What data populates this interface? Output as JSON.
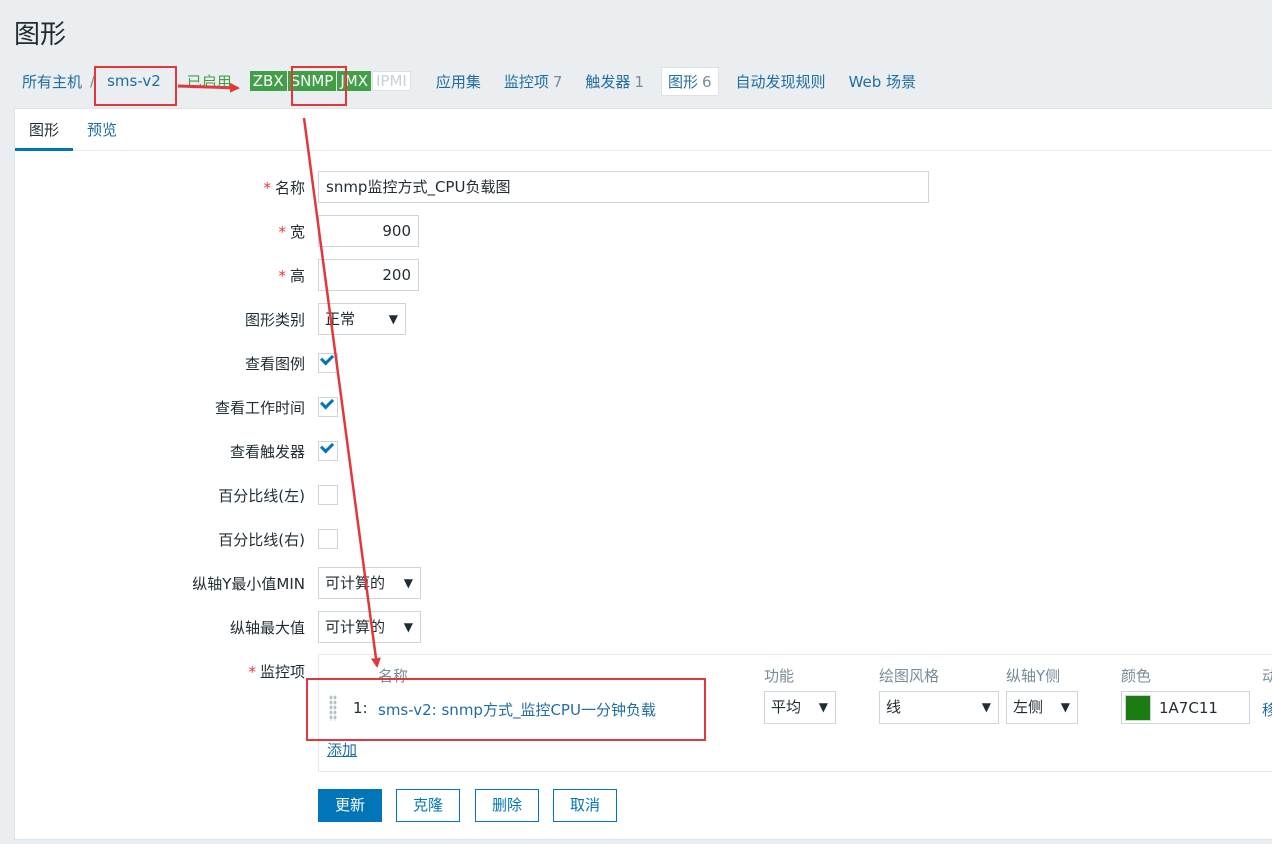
{
  "page": {
    "title": "图形"
  },
  "host_nav": {
    "all_hosts": "所有主机",
    "separator": "/",
    "host": "sms-v2",
    "status": "已启用",
    "availability": [
      {
        "label": "ZBX",
        "state": "on"
      },
      {
        "label": "SNMP",
        "state": "on"
      },
      {
        "label": "JMX",
        "state": "on"
      },
      {
        "label": "IPMI",
        "state": "off"
      }
    ],
    "items": [
      {
        "label": "应用集",
        "count": ""
      },
      {
        "label": "监控项",
        "count": "7"
      },
      {
        "label": "触发器",
        "count": "1"
      },
      {
        "label": "图形",
        "count": "6",
        "active": true
      },
      {
        "label": "自动发现规则",
        "count": ""
      },
      {
        "label": "Web 场景",
        "count": ""
      }
    ]
  },
  "tabs": [
    {
      "label": "图形",
      "active": true
    },
    {
      "label": "预览",
      "active": false
    }
  ],
  "form": {
    "name": {
      "label": "名称",
      "value": "snmp监控方式_CPU负载图"
    },
    "width": {
      "label": "宽",
      "value": "900"
    },
    "height": {
      "label": "高",
      "value": "200"
    },
    "graph_type": {
      "label": "图形类别",
      "value": "正常"
    },
    "show_legend": {
      "label": "查看图例",
      "checked": true
    },
    "show_work_period": {
      "label": "查看工作时间",
      "checked": true
    },
    "show_triggers": {
      "label": "查看触发器",
      "checked": true
    },
    "percentile_left": {
      "label": "百分比线(左)",
      "checked": false
    },
    "percentile_right": {
      "label": "百分比线(右)",
      "checked": false
    },
    "y_min": {
      "label": "纵轴Y最小值MIN",
      "value": "可计算的"
    },
    "y_max": {
      "label": "纵轴最大值",
      "value": "可计算的"
    },
    "items_label": "监控项"
  },
  "items_table": {
    "headers": {
      "name": "名称",
      "function": "功能",
      "draw_style": "绘图风格",
      "y_side": "纵轴Y侧",
      "color": "颜色",
      "action": "动"
    },
    "rows": [
      {
        "num": "1:",
        "name": "sms-v2: snmp方式_监控CPU一分钟负载",
        "function": "平均",
        "draw_style": "线",
        "y_side": "左侧",
        "color": "1A7C11",
        "action": "移"
      }
    ],
    "add_link": "添加"
  },
  "buttons": {
    "update": "更新",
    "clone": "克隆",
    "delete": "删除",
    "cancel": "取消"
  },
  "colors": {
    "accent": "#0275b8",
    "link": "#1f6da3",
    "enabled": "#429e47",
    "annotation_red": "#e0383b",
    "item_color": "#1A7C11"
  }
}
